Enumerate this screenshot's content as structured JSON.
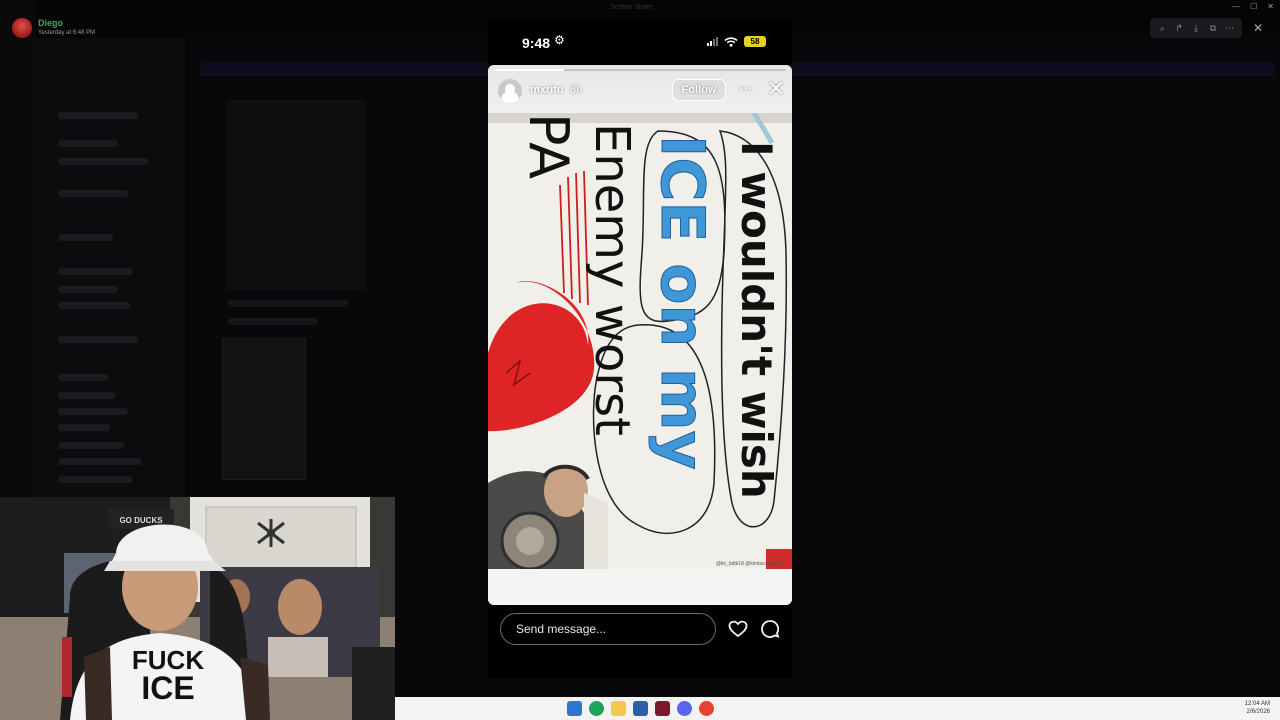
{
  "window": {
    "title": "Screen Share",
    "toolbar_icons": [
      "zoom-icon",
      "share-icon",
      "download-icon",
      "popout-icon",
      "more-icon"
    ],
    "close_glyph": "✕"
  },
  "message_author": {
    "name": "Diego",
    "timestamp": "Yesterday at 6:48 PM",
    "name_color": "#3ba55d"
  },
  "phone_status": {
    "time": "9:48",
    "battery": "58",
    "battery_color": "#e5d320"
  },
  "story": {
    "username": "mxrito",
    "age": "8h",
    "follow_label": "Follow",
    "more_glyph": "···",
    "close_glyph": "✕",
    "progress_fraction": 0.24,
    "sign_text": {
      "line1": "I wouldn't wish",
      "line2": "ICE on my",
      "line3": "Enemy worst",
      "line4": "PA"
    },
    "photo_credit": "@its_bdtk18 @kimlaccelbutta"
  },
  "reply": {
    "placeholder": "Send message..."
  },
  "taskbar": {
    "time": "12:04 AM",
    "date": "2/6/2026"
  },
  "webcam": {
    "shirt_line1": "FUCK",
    "shirt_line2": "ICE",
    "cap_text": "GO DUCKS"
  }
}
